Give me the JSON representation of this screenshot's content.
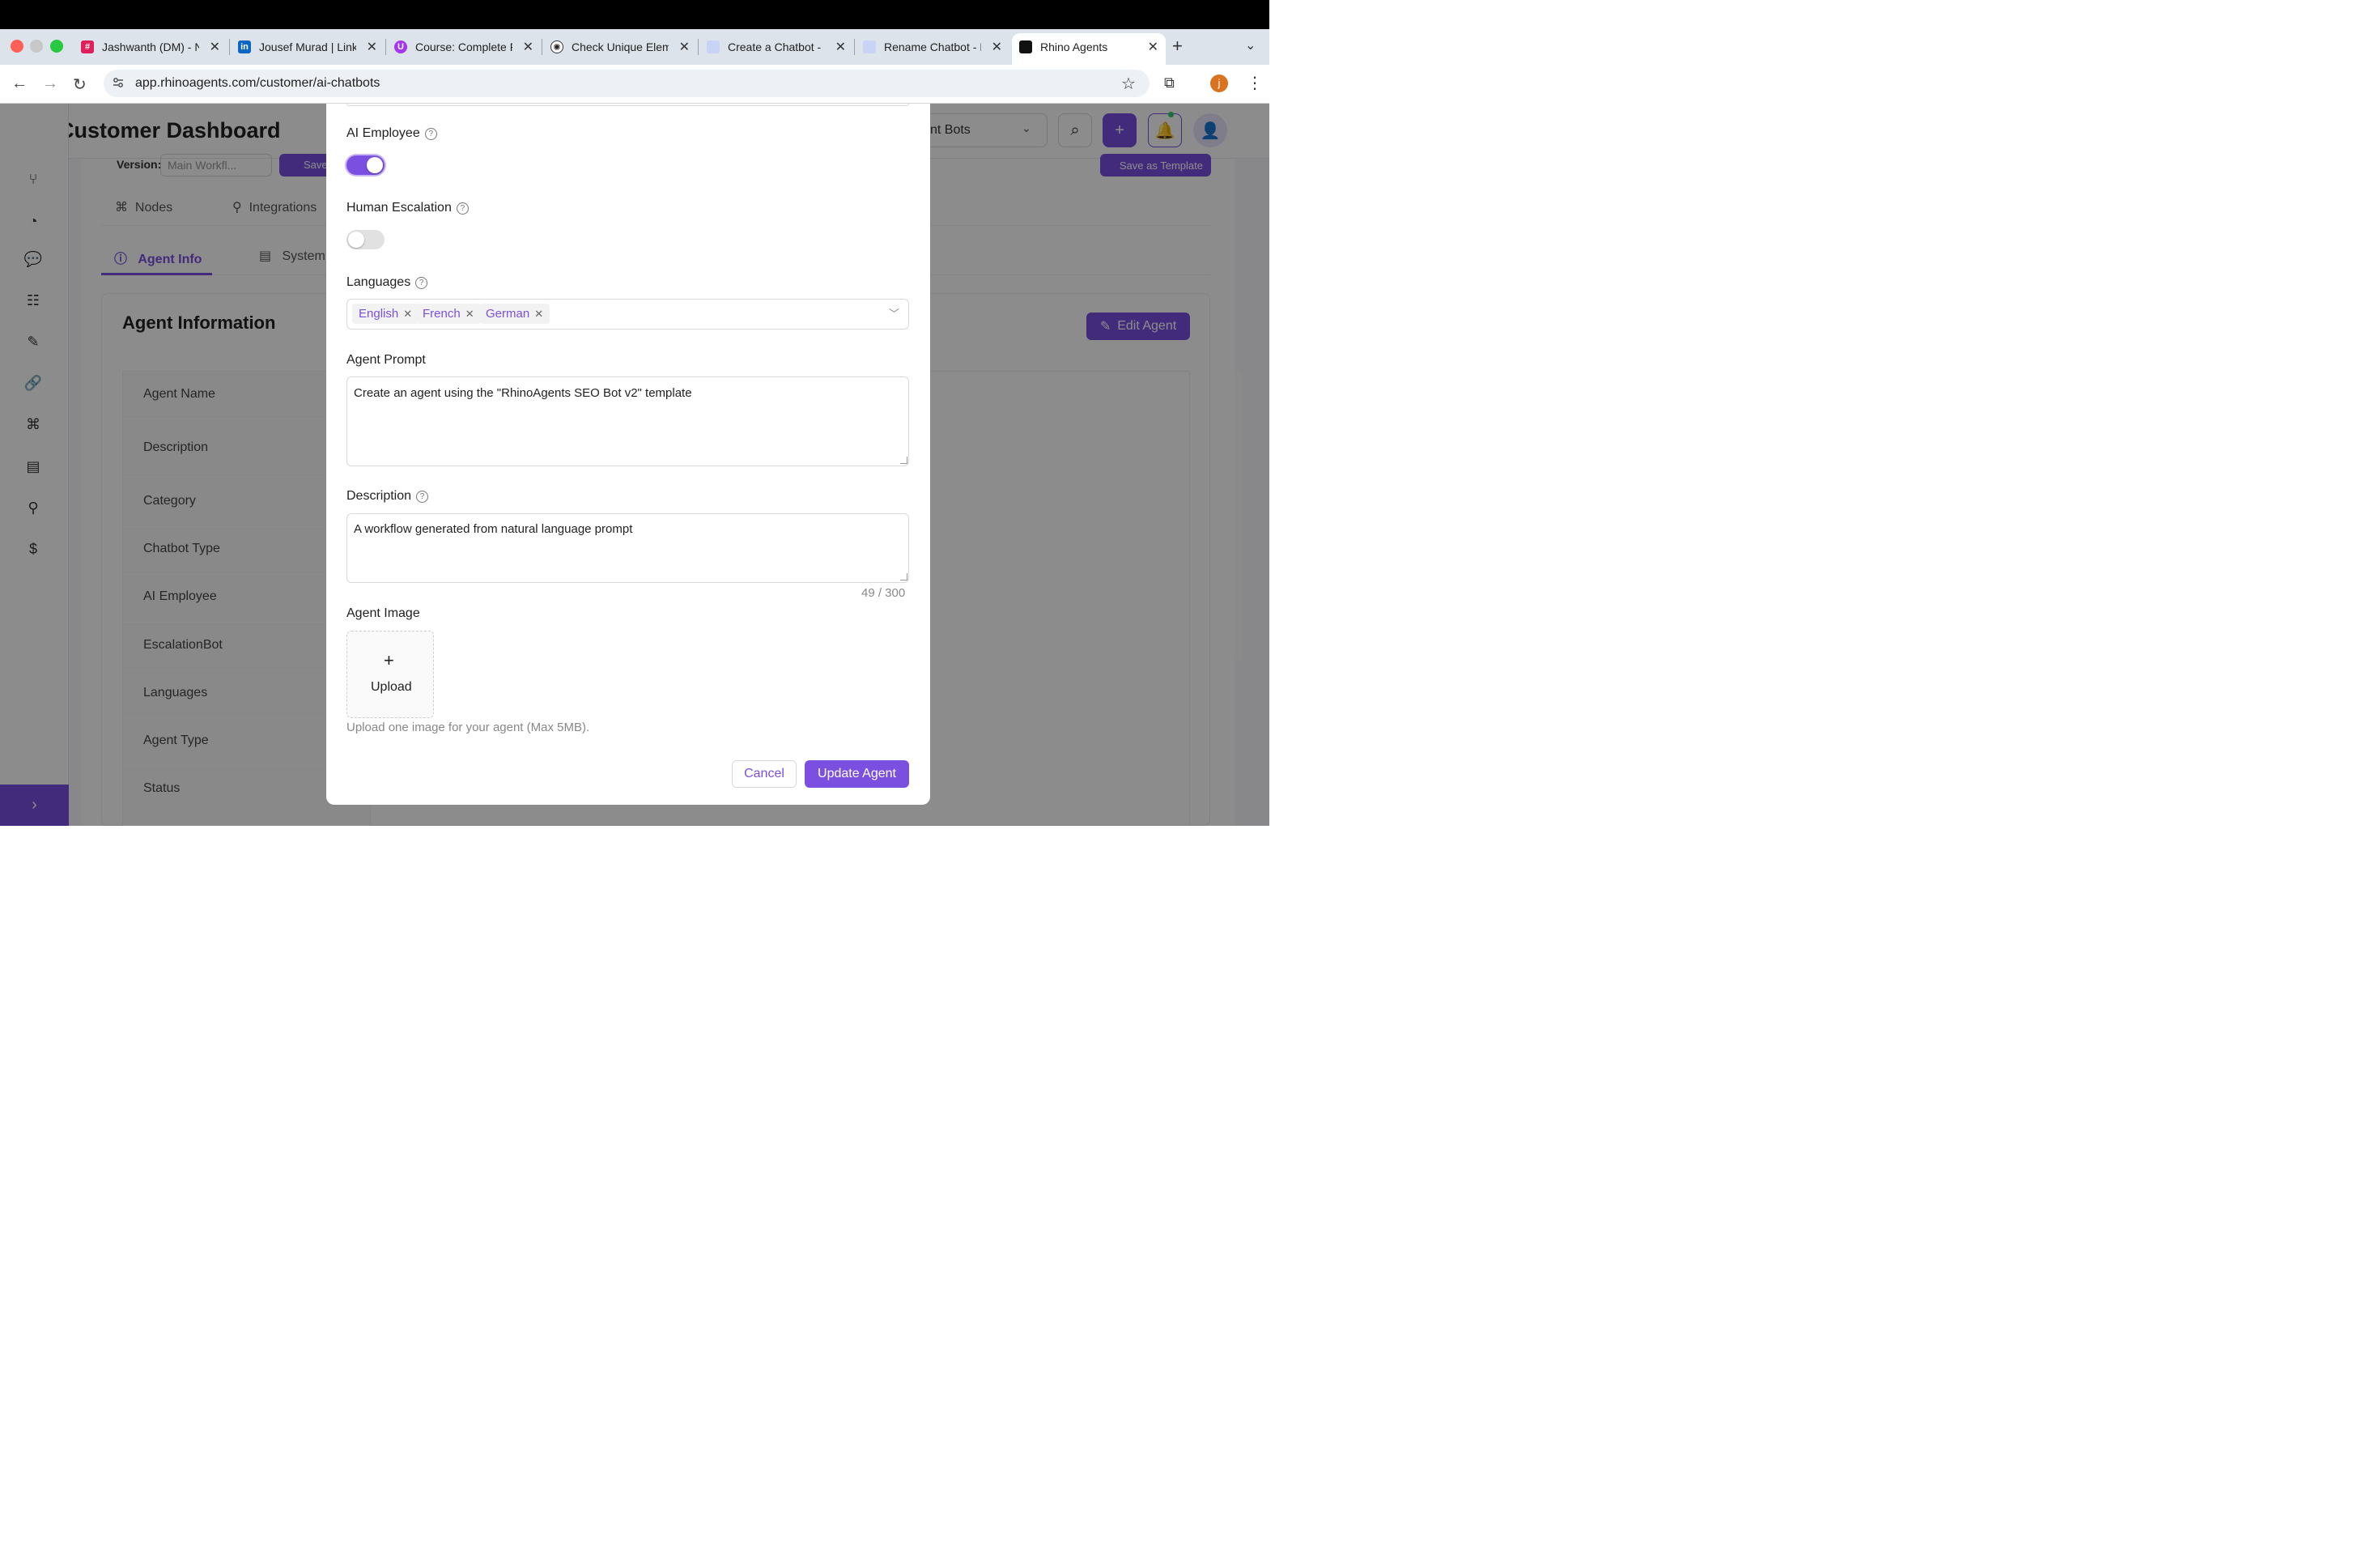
{
  "browser": {
    "tabs": [
      {
        "label": "Jashwanth (DM) - N",
        "icon": "slack-icon"
      },
      {
        "label": "Jousef Murad | Link",
        "icon": "linkedin-icon"
      },
      {
        "label": "Course: Complete F",
        "icon": "udemy-icon"
      },
      {
        "label": "Check Unique Elem",
        "icon": "openai-icon"
      },
      {
        "label": "Create a Chatbot -",
        "icon": "loom-icon"
      },
      {
        "label": "Rename Chatbot - I",
        "icon": "loom-icon"
      },
      {
        "label": "Rhino Agents",
        "icon": "rhino-icon",
        "active": true
      }
    ],
    "url": "app.rhinoagents.com/customer/ai-chatbots",
    "profile_initial": "j"
  },
  "app": {
    "title": "Customer Dashboard",
    "header_select": "nt Bots",
    "version_label": "Version:",
    "version_value": "Main Workfl...",
    "save_label": "Save",
    "save_template_label": "Save as Template",
    "top_tabs": [
      "Nodes",
      "Integrations"
    ],
    "sub_tabs": [
      "Agent Info",
      "System"
    ],
    "info_title": "Agent Information",
    "edit_agent_label": "Edit Agent",
    "info_rows": [
      "Agent Name",
      "Description",
      "Category",
      "Chatbot Type",
      "AI Employee",
      "EscalationBot",
      "Languages",
      "Agent Type",
      "Status"
    ]
  },
  "modal": {
    "ai_employee_label": "AI Employee",
    "ai_employee_on": true,
    "human_escalation_label": "Human Escalation",
    "human_escalation_on": false,
    "languages_label": "Languages",
    "languages": [
      "English",
      "French",
      "German"
    ],
    "agent_prompt_label": "Agent Prompt",
    "agent_prompt_value": "Create an agent using the \"RhinoAgents SEO Bot v2\" template",
    "description_label": "Description",
    "description_value": "A workflow generated from natural language prompt",
    "description_counter": "49 / 300",
    "agent_image_label": "Agent Image",
    "upload_label": "Upload",
    "upload_help": "Upload one image for your agent (Max 5MB).",
    "cancel_label": "Cancel",
    "update_label": "Update Agent"
  },
  "colors": {
    "accent": "#7b4fe0"
  }
}
